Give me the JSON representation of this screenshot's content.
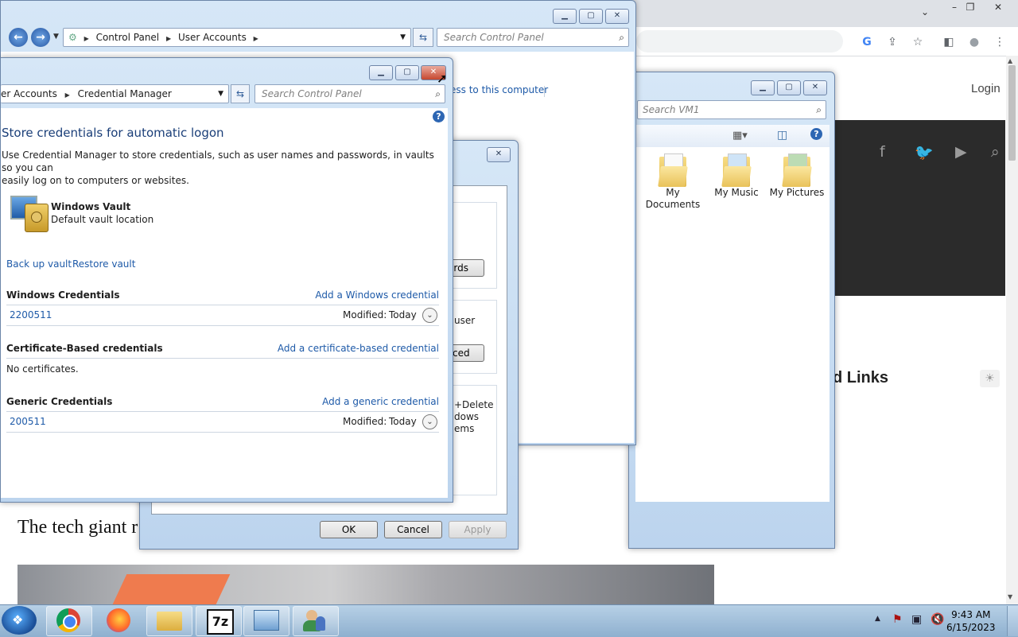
{
  "chrome": {
    "controls": {
      "minimize": "–",
      "restore": "❐",
      "close": "✕"
    },
    "tab_dropdown": "⌄",
    "toolbar_icons": [
      "G",
      "⇪",
      "☆",
      "◧",
      "●",
      "⋮"
    ]
  },
  "website": {
    "login": "Login",
    "social": [
      "f",
      "🐦",
      "▶",
      "⌕"
    ],
    "related_links": "d Links",
    "headline": "The tech giant r"
  },
  "user_accounts_window": {
    "breadcrumb": [
      "Control Panel",
      "User Accounts"
    ],
    "search_placeholder": "Search Control Panel",
    "partial_link": "ess to this computer"
  },
  "vm1_window": {
    "search_placeholder": "Search VM1",
    "folders": [
      {
        "label": "My Documents"
      },
      {
        "label": "My Music"
      },
      {
        "label": "My Pictures"
      }
    ]
  },
  "dialog": {
    "partial_button_1": "ords",
    "partial_text_user": "user",
    "partial_button_2": "nced",
    "partial_text_delete": "+Delete",
    "partial_text_dows": "dows",
    "partial_text_ems": "ems",
    "ok": "OK",
    "cancel": "Cancel",
    "apply": "Apply"
  },
  "credential_manager": {
    "breadcrumb": [
      "er Accounts",
      "Credential Manager"
    ],
    "search_placeholder": "Search Control Panel",
    "title": "Store credentials for automatic logon",
    "description_line1": "Use Credential Manager to store credentials, such as user names and passwords, in vaults so you can",
    "description_line2": "easily log on to computers or websites.",
    "vault_name": "Windows Vault",
    "vault_desc": "Default vault location",
    "backup_link": "Back up vault",
    "restore_link": "Restore vault",
    "sections": [
      {
        "title": "Windows Credentials",
        "add_link": "Add a Windows credential",
        "entry": "2200511",
        "modified_label": "Modified:",
        "modified_value": "Today"
      },
      {
        "title": "Certificate-Based credentials",
        "add_link": "Add a certificate-based credential",
        "empty_text": "No certificates."
      },
      {
        "title": "Generic Credentials",
        "add_link": "Add a generic credential",
        "entry": "200511",
        "modified_label": "Modified:",
        "modified_value": "Today"
      }
    ]
  },
  "taskbar": {
    "items": [
      "chrome",
      "firefox",
      "explorer",
      "7z",
      "control-panel",
      "user-accounts"
    ],
    "seven_zip_label": "7z",
    "time": "9:43 AM",
    "date": "6/15/2023"
  }
}
